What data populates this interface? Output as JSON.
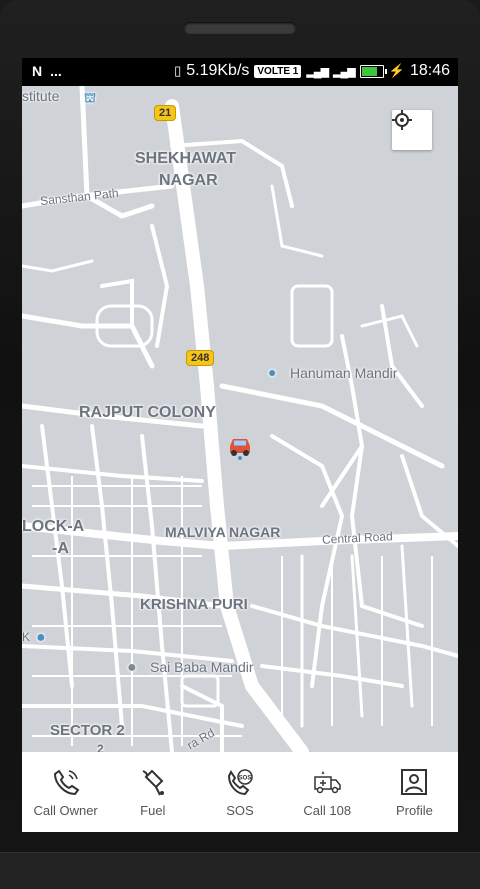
{
  "status_bar": {
    "left_icons": [
      "N",
      "..."
    ],
    "network_speed": "5.19Kb/s",
    "volte": "VOLTE 1",
    "time": "18:46"
  },
  "map": {
    "labels": {
      "institute": "stitute",
      "shekhawat": "SHEKHAWAT",
      "nagar": "NAGAR",
      "sansthan_path": "Sansthan Path",
      "hanuman_mandir": "Hanuman Mandir",
      "rajput_colony": "RAJPUT COLONY",
      "block_a_1": "LOCK-A",
      "block_a_2": "-A",
      "malviya_nagar": "MALVIYA NAGAR",
      "central_road": "Central Road",
      "krishna_puri": "KRISHNA PURI",
      "sai_baba_mandir": "Sai Baba Mandir",
      "sector_2": "SECTOR 2",
      "sector_2b": "2",
      "ra_rd": "ra Rd",
      "k": "K"
    },
    "shields": {
      "route_21": "21",
      "route_248": "248"
    },
    "locate_button_icon": "crosshair-icon",
    "vehicle_icon": "car-icon"
  },
  "bottom_nav": [
    {
      "label": "Call Owner",
      "icon": "phone-icon"
    },
    {
      "label": "Fuel",
      "icon": "fuel-pump-icon"
    },
    {
      "label": "SOS",
      "icon": "sos-icon"
    },
    {
      "label": "Call 108",
      "icon": "ambulance-icon"
    },
    {
      "label": "Profile",
      "icon": "profile-icon"
    }
  ],
  "colors": {
    "map_bg": "#cfd2d6",
    "road": "#ffffff",
    "label": "#6b7480",
    "shield": "#f5c518"
  }
}
